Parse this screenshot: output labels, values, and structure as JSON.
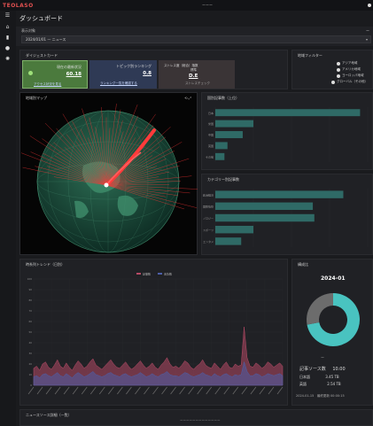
{
  "app": {
    "name": "TEOLASO",
    "center_text": "ーーー"
  },
  "page": {
    "title": "ダッシュボード"
  },
  "filter": {
    "label": "表示対象",
    "selected": "2024/01/01 — ニュース",
    "dash": "ー"
  },
  "kpis": {
    "title": "ダイジェストカード",
    "items": [
      {
        "title": "現在の最新状況",
        "value": "60.18",
        "link": "アクセス状況を見る"
      },
      {
        "title": "トピック別ランキング",
        "value": "0.8",
        "link": "ランキング一覧を確認する"
      },
      {
        "title": "ストレス度（総合）指数",
        "sub": "標準",
        "value": "D.E",
        "link": "ストレスチェック"
      }
    ]
  },
  "legend_panel": {
    "title": "地域フィルター",
    "items": [
      "アジア地域",
      "アメリカ地域",
      "ヨーロッパ地域",
      "グローバル（その他）"
    ]
  },
  "globe": {
    "title": "地域別マップ",
    "tools": "⟲ ⤢"
  },
  "bar1": {
    "title": "国別記事数（上位）",
    "labels": [
      "日本",
      "米国",
      "中国",
      "英国",
      "その他"
    ],
    "values": [
      95,
      25,
      18,
      8,
      6
    ]
  },
  "bar2": {
    "title": "カテゴリー別記事数",
    "labels": [
      "政治経済",
      "国際情勢",
      "テクノロジー",
      "スポーツ",
      "エンタメ"
    ],
    "values": [
      84,
      64,
      65,
      25,
      17
    ]
  },
  "timeline": {
    "title": "時系列トレンド（日別）",
    "legend": [
      "記事数",
      "言及数"
    ]
  },
  "donut": {
    "title": "構成比",
    "period": "2024-01",
    "colors": [
      "#49c3c0",
      "#6c6c6c"
    ],
    "shares": [
      0.72,
      0.28
    ],
    "legend": "ー",
    "stats": [
      {
        "k": "記事ソース数",
        "v": "10.00"
      },
      {
        "k": "日本語",
        "v": "3.45 TB"
      },
      {
        "k": "英語",
        "v": "2.54 TB"
      }
    ],
    "footer": "2024-01-15　最終更新 00:00:15"
  },
  "bottom_panel": {
    "title": "ニュースソース詳細（一覧）",
    "subtitle": "ーーーーーーーーーーーーー"
  },
  "chart_data": [
    {
      "type": "bar",
      "categories": [
        "日本",
        "米国",
        "中国",
        "英国",
        "その他"
      ],
      "values": [
        95,
        25,
        18,
        8,
        6
      ],
      "title": "国別記事数（上位）",
      "xlim": [
        0,
        100
      ]
    },
    {
      "type": "bar",
      "categories": [
        "政治経済",
        "国際情勢",
        "テクノロジー",
        "スポーツ",
        "エンタメ"
      ],
      "values": [
        84,
        64,
        65,
        25,
        17
      ],
      "title": "カテゴリー別記事数",
      "xlim": [
        0,
        100
      ]
    },
    {
      "type": "area",
      "title": "時系列トレンド（日別）",
      "ylim": [
        0,
        100
      ],
      "series": [
        {
          "name": "記事数",
          "values": [
            16,
            18,
            14,
            20,
            22,
            17,
            15,
            19,
            24,
            18,
            16,
            21,
            17,
            14,
            19,
            23,
            20,
            16,
            18,
            22,
            25,
            19,
            17,
            15,
            18,
            21,
            24,
            20,
            17,
            16,
            19,
            22,
            18,
            15,
            17,
            20,
            23,
            19,
            16,
            18,
            21,
            17,
            15,
            19,
            22,
            26,
            20,
            17,
            18,
            16,
            19,
            23,
            21,
            17,
            15,
            18,
            20,
            24,
            19,
            17,
            16,
            21,
            18,
            15,
            19,
            22,
            17,
            16,
            20,
            18,
            19,
            55,
            26,
            18,
            17,
            21,
            19,
            16,
            18,
            22,
            20,
            17,
            19,
            21,
            18
          ]
        },
        {
          "name": "言及数",
          "values": [
            8,
            9,
            7,
            10,
            11,
            9,
            8,
            10,
            12,
            9,
            8,
            11,
            9,
            7,
            10,
            12,
            10,
            8,
            9,
            11,
            13,
            10,
            9,
            8,
            9,
            11,
            12,
            10,
            9,
            8,
            10,
            11,
            9,
            8,
            9,
            10,
            12,
            10,
            8,
            9,
            11,
            9,
            8,
            10,
            11,
            13,
            10,
            9,
            9,
            8,
            10,
            12,
            11,
            9,
            8,
            9,
            10,
            12,
            10,
            9,
            8,
            11,
            9,
            8,
            10,
            11,
            9,
            8,
            10,
            9,
            10,
            22,
            13,
            9,
            9,
            11,
            10,
            8,
            9,
            11,
            10,
            9,
            10,
            11,
            9
          ]
        }
      ]
    },
    {
      "type": "pie",
      "title": "構成比",
      "categories": [
        "A",
        "B"
      ],
      "values": [
        72,
        28
      ]
    }
  ]
}
